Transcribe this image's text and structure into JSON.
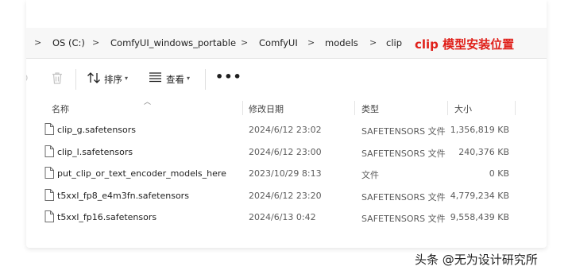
{
  "breadcrumb": {
    "items": [
      "OS (C:)",
      "ComfyUI_windows_portable",
      "ComfyUI",
      "models",
      "clip"
    ],
    "annotation": "clip 模型安装位置",
    "annotation_color": "#e0201a"
  },
  "toolbar": {
    "sort_label": "排序",
    "view_label": "查看",
    "more_label": "•••"
  },
  "columns": {
    "name": "名称",
    "date": "修改日期",
    "type": "类型",
    "size": "大小"
  },
  "files": [
    {
      "name": "clip_g.safetensors",
      "date": "2024/6/12 23:02",
      "type": "SAFETENSORS 文件",
      "size": "1,356,819 KB"
    },
    {
      "name": "clip_l.safetensors",
      "date": "2024/6/12 23:00",
      "type": "SAFETENSORS 文件",
      "size": "240,376 KB"
    },
    {
      "name": "put_clip_or_text_encoder_models_here",
      "date": "2023/10/29 8:13",
      "type": "文件",
      "size": "0 KB"
    },
    {
      "name": "t5xxl_fp8_e4m3fn.safetensors",
      "date": "2024/6/12 23:20",
      "type": "SAFETENSORS 文件",
      "size": "4,779,234 KB"
    },
    {
      "name": "t5xxl_fp16.safetensors",
      "date": "2024/6/13 0:42",
      "type": "SAFETENSORS 文件",
      "size": "9,558,439 KB"
    }
  ],
  "watermark": "头条 @无为设计研究所"
}
